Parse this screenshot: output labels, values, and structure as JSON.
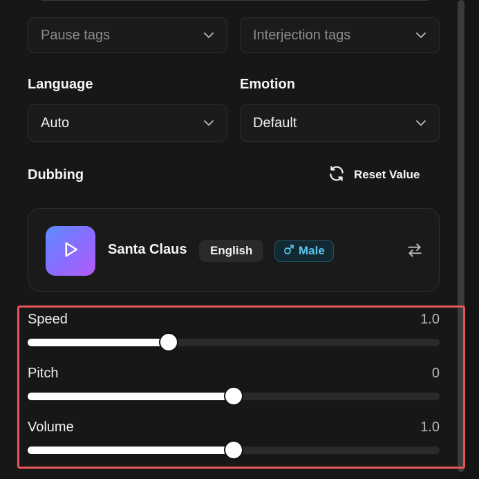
{
  "tags": {
    "pause_placeholder": "Pause tags",
    "interjection_placeholder": "Interjection tags"
  },
  "language": {
    "label": "Language",
    "value": "Auto"
  },
  "emotion": {
    "label": "Emotion",
    "value": "Default"
  },
  "dubbing": {
    "label": "Dubbing",
    "reset_label": "Reset Value",
    "voice": {
      "name": "Santa Claus",
      "language": "English",
      "gender": "Male",
      "thumb_gradient": [
        "#5b8cff",
        "#b25cf7"
      ]
    }
  },
  "sliders": [
    {
      "label": "Speed",
      "value": "1.0",
      "level": 0.343
    },
    {
      "label": "Pitch",
      "value": "0",
      "level": 0.5
    },
    {
      "label": "Volume",
      "value": "1.0",
      "level": 0.5
    }
  ],
  "colors": {
    "accent_highlight": "#e8555b",
    "male_badge": "#5cc4ea"
  }
}
